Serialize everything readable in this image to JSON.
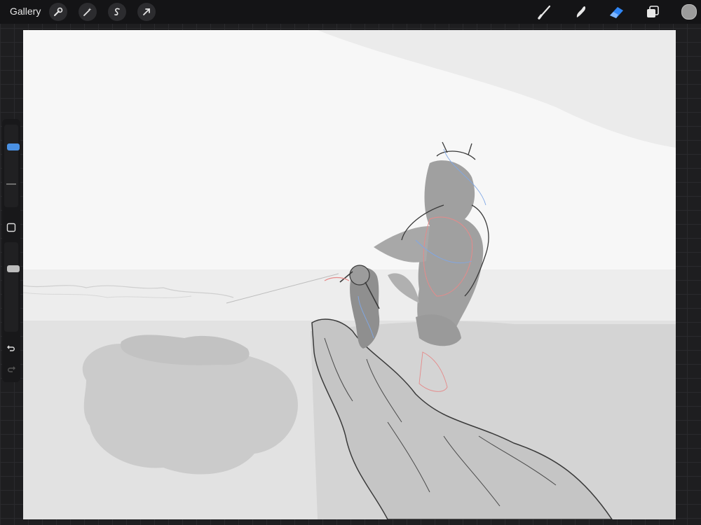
{
  "topbar": {
    "gallery_label": "Gallery",
    "left_tools": [
      {
        "icon": "wrench-icon"
      },
      {
        "icon": "magic-wand-icon"
      },
      {
        "icon": "selection-s-icon"
      },
      {
        "icon": "transform-arrow-icon"
      }
    ],
    "right_tools": [
      {
        "icon": "brush-icon"
      },
      {
        "icon": "smudge-icon"
      },
      {
        "icon": "eraser-icon",
        "active": true
      },
      {
        "icon": "layers-icon"
      }
    ],
    "current_color": "#9b9b9b"
  },
  "sidebar": {
    "brush_size_level": 0.75,
    "opacity_level": 0.72,
    "buttons": [
      {
        "icon": "square-modify-icon"
      },
      {
        "icon": "undo-icon"
      },
      {
        "icon": "redo-icon"
      }
    ]
  },
  "colors": {
    "accent": "#2f86f6",
    "canvas_bg": "#f7f7f7",
    "sketch_gray": "#c9c9c9",
    "shadow_gray": "#8f8f8f",
    "lineart": "#3a3a3a"
  }
}
